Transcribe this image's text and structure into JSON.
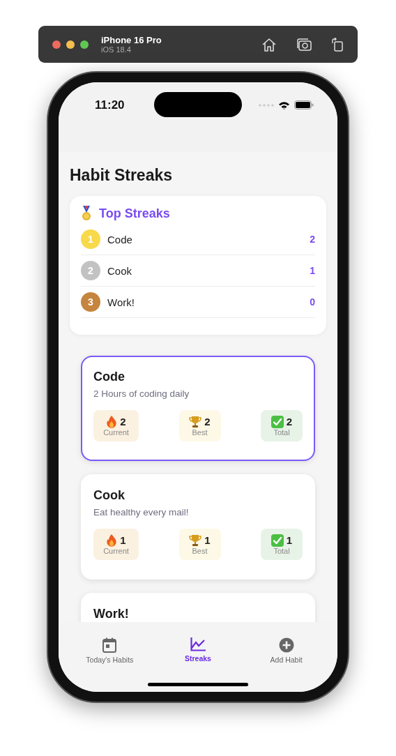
{
  "simulator": {
    "device": "iPhone 16 Pro",
    "os": "iOS 18.4"
  },
  "status_bar": {
    "time": "11:20"
  },
  "title": "Habit Streaks",
  "top_streaks": {
    "title": "Top Streaks",
    "items": [
      {
        "rank": "1",
        "name": "Code",
        "streak": "2",
        "color": "#f8d94a"
      },
      {
        "rank": "2",
        "name": "Cook",
        "streak": "1",
        "color": "#c2c2c2"
      },
      {
        "rank": "3",
        "name": "Work!",
        "streak": "0",
        "color": "#c5853e"
      }
    ]
  },
  "habits": [
    {
      "name": "Code",
      "description": "2 Hours of coding daily",
      "selected": true,
      "stats": [
        {
          "kind": "current",
          "value": "2",
          "label": "Current"
        },
        {
          "kind": "best",
          "value": "2",
          "label": "Best"
        },
        {
          "kind": "total",
          "value": "2",
          "label": "Total"
        }
      ]
    },
    {
      "name": "Cook",
      "description": "Eat healthy every mail!",
      "selected": false,
      "stats": [
        {
          "kind": "current",
          "value": "1",
          "label": "Current"
        },
        {
          "kind": "best",
          "value": "1",
          "label": "Best"
        },
        {
          "kind": "total",
          "value": "1",
          "label": "Total"
        }
      ]
    },
    {
      "name": "Work!",
      "selected": false
    }
  ],
  "tabs": [
    {
      "kind": "today",
      "label": "Today's Habits",
      "selected": false
    },
    {
      "kind": "streaks",
      "label": "Streaks",
      "selected": true
    },
    {
      "kind": "add",
      "label": "Add Habit",
      "selected": false
    }
  ]
}
